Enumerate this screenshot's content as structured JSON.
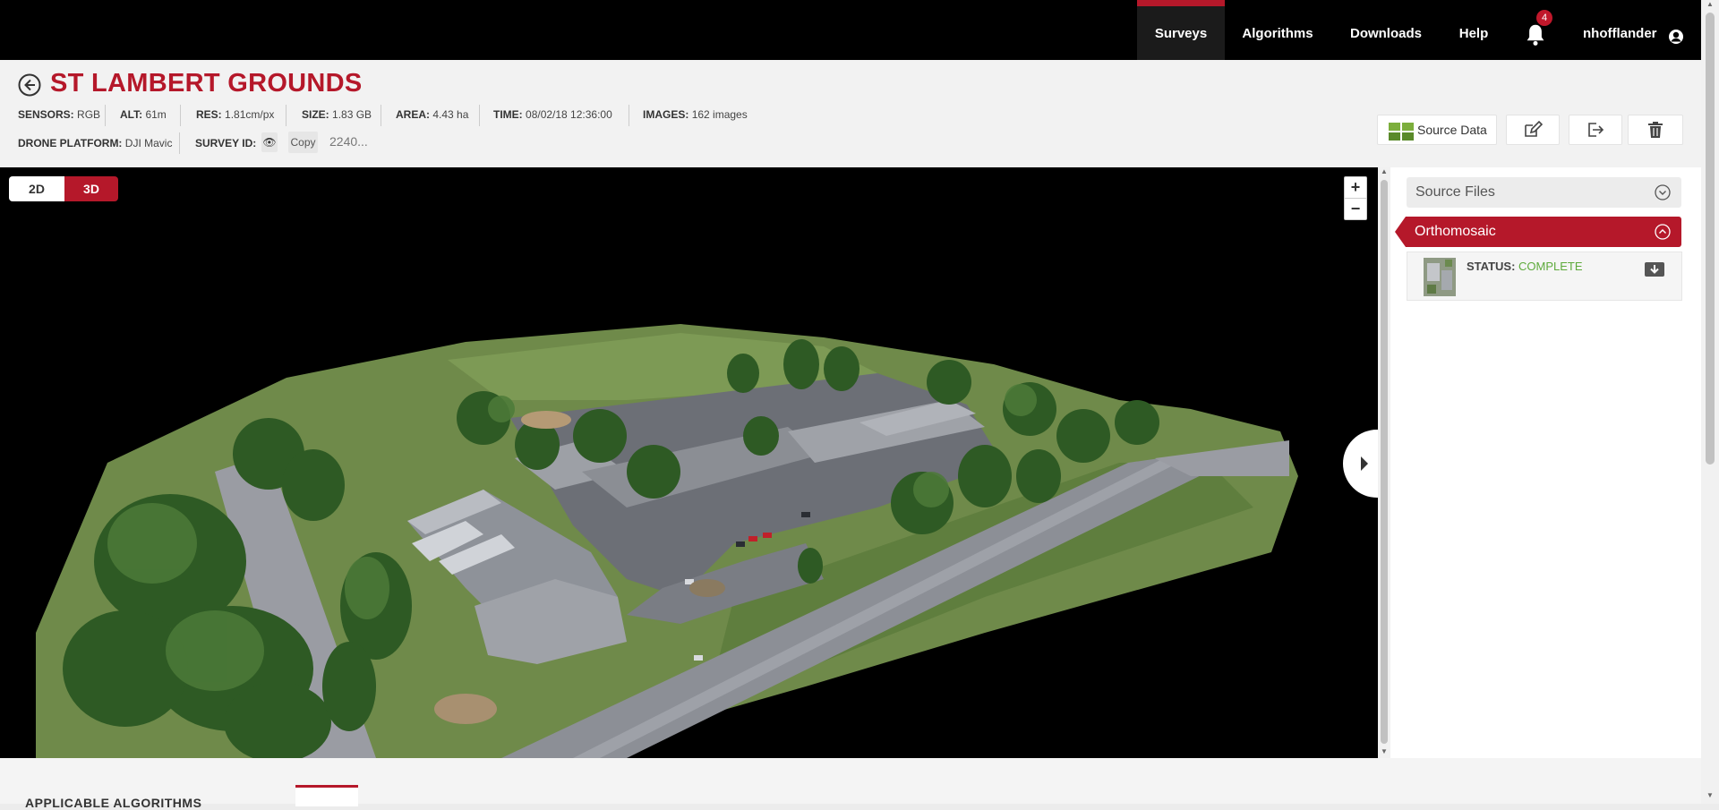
{
  "nav": {
    "items": [
      {
        "label": "Surveys",
        "active": true
      },
      {
        "label": "Algorithms"
      },
      {
        "label": "Downloads"
      },
      {
        "label": "Help"
      }
    ],
    "notification_count": "4",
    "username": "nhofflander"
  },
  "survey": {
    "title": "ST LAMBERT GROUNDS",
    "meta": {
      "sensors": {
        "label": "SENSORS:",
        "value": "RGB"
      },
      "alt": {
        "label": "ALT:",
        "value": "61m"
      },
      "res": {
        "label": "RES:",
        "value": "1.81cm/px"
      },
      "size": {
        "label": "SIZE:",
        "value": "1.83 GB"
      },
      "area": {
        "label": "AREA:",
        "value": "4.43 ha"
      },
      "time": {
        "label": "TIME:",
        "value": "08/02/18 12:36:00"
      },
      "images": {
        "label": "IMAGES:",
        "value": "162 images"
      },
      "platform": {
        "label": "DRONE PLATFORM:",
        "value": "DJI Mavic"
      },
      "survey_id": {
        "label": "SURVEY ID:",
        "value": "2240..."
      }
    },
    "copy_label": "Copy",
    "eye_glyph": "👁",
    "source_data_label": "Source Data"
  },
  "viewer": {
    "mode_2d": "2D",
    "mode_3d": "3D",
    "active_mode": "3D",
    "zoom_in": "+",
    "zoom_out": "−"
  },
  "sidebar": {
    "source_files_label": "Source Files",
    "orthomosaic_label": "Orthomosaic",
    "status_key": "STATUS:",
    "status_value": "COMPLETE"
  },
  "bottom": {
    "heading": "APPLICABLE ALGORITHMS"
  },
  "colors": {
    "accent": "#b5182a",
    "status_complete": "#5eaa3c",
    "nav_bg": "#000000"
  },
  "icons": [
    "back-arrow-icon",
    "bell-icon",
    "user-icon",
    "grid-icon",
    "edit-icon",
    "export-icon",
    "trash-icon",
    "chevron-down-icon",
    "chevron-up-icon",
    "download-icon",
    "eye-icon",
    "chevron-right-icon"
  ]
}
